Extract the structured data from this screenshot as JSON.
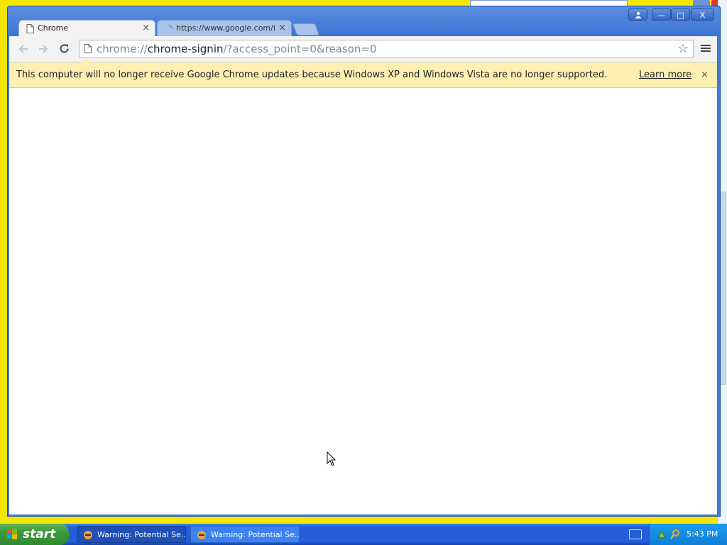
{
  "browser": {
    "tabs": [
      {
        "label": "Chrome",
        "active": true
      },
      {
        "label": "https://www.google.com/intl/en/chrome/",
        "active": false
      }
    ],
    "close_glyph": "×",
    "url": {
      "scheme": "chrome://",
      "host": "chrome-signin",
      "path": "/?access_point=0&reason=0"
    },
    "infobar": {
      "message": "This computer will no longer receive Google Chrome updates because Windows XP and Windows Vista are no longer supported.",
      "link": "Learn more",
      "close": "×"
    }
  },
  "window_controls": {
    "minimize": "—",
    "maximize": "□",
    "close": "X"
  },
  "taskbar": {
    "start_label": "start",
    "tasks": [
      {
        "label": "Warning: Potential Se..."
      },
      {
        "label": "Warning: Potential Se..."
      }
    ],
    "clock": "5:43 PM"
  },
  "icons": {
    "back": "arrow-left-icon",
    "forward": "arrow-right-icon",
    "reload": "reload-icon",
    "star": "bookmark-star-icon",
    "menu": "hamburger-menu-icon"
  },
  "colors": {
    "infobar_bg": "#fdf0b2",
    "taskbar": "#245edb",
    "start_green": "#3c9a3a",
    "desktop": "#f5e600"
  }
}
